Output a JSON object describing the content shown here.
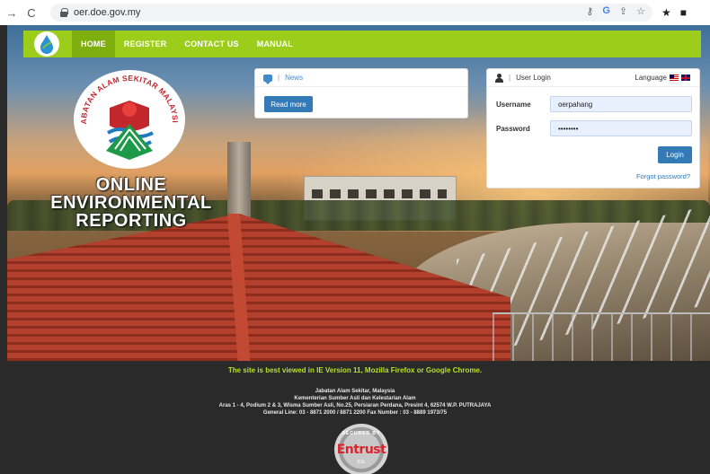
{
  "browser": {
    "url": "oer.doe.gov.my",
    "back_icon": "arrow-left-icon",
    "reload_icon": "reload-icon"
  },
  "nav": {
    "items": [
      "HOME",
      "REGISTER",
      "CONTACT US",
      "MANUAL"
    ],
    "active": "HOME",
    "accent_color": "#9ccd1a"
  },
  "seal": {
    "text": "JABATAN ALAM SEKITAR MALAYSIA"
  },
  "hero": {
    "title_line1": "ONLINE",
    "title_line2": "ENVIRONMENTAL",
    "title_line3": "REPORTING"
  },
  "news": {
    "heading": "News",
    "read_more": "Read more"
  },
  "login": {
    "heading": "User Login",
    "language_label": "Language",
    "username_label": "Username",
    "username_value": "oerpahang",
    "password_label": "Password",
    "password_value": "••••••••",
    "login_button": "Login",
    "forgot_link": "Forgot password?"
  },
  "footer": {
    "note": "The site is best viewed in IE Version 11, Mozilla Firefox or Google Chrome.",
    "org1": "Jabatan Alam Sekitar, Malaysia",
    "org2": "Kementerian Sumber Asli dan Kelestarian Alam",
    "address": "Aras 1 - 4, Podium 2 & 3, Wisma Sumber Asli, No.25, Persiaran Perdana, Presint 4, 62574 W.P. PUTRAJAYA",
    "phone": "General Line: 03 - 8871 2000 / 8871 2200 Fax Number : 03 - 8889 1973/75",
    "badge_top": "SECURED BY",
    "badge_word": "Entrust",
    "badge_ssl": "SSL"
  }
}
